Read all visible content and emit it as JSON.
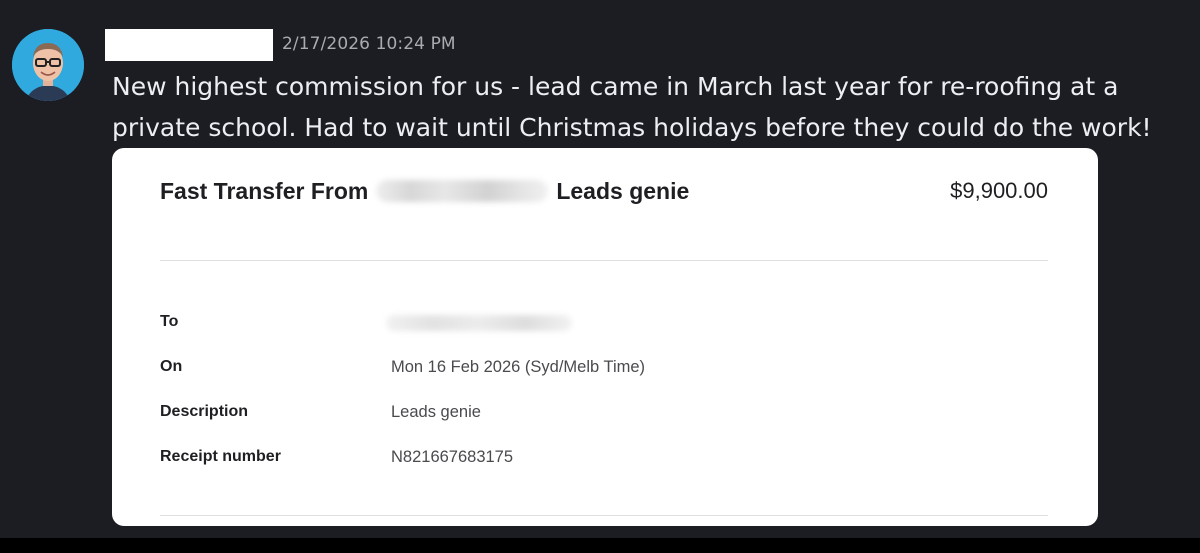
{
  "message": {
    "timestamp": "2/17/2026 10:24 PM",
    "text": "New highest commission for us - lead came in March last year for re-roofing at a private school. Had to wait until Christmas holidays before they could do the work!"
  },
  "receipt": {
    "title_prefix": "Fast Transfer From",
    "title_suffix": "Leads genie",
    "amount": "$9,900.00",
    "rows": [
      {
        "label": "To",
        "value": ""
      },
      {
        "label": "On",
        "value": "Mon 16 Feb 2026 (Syd/Melb Time)"
      },
      {
        "label": "Description",
        "value": "Leads genie"
      },
      {
        "label": "Receipt number",
        "value": "N821667683175"
      }
    ]
  },
  "colors": {
    "background": "#1c1d22",
    "avatar_bg": "#2fa9de",
    "card_bg": "#ffffff",
    "text_primary": "#eceef2",
    "timestamp": "#a9abb2"
  }
}
